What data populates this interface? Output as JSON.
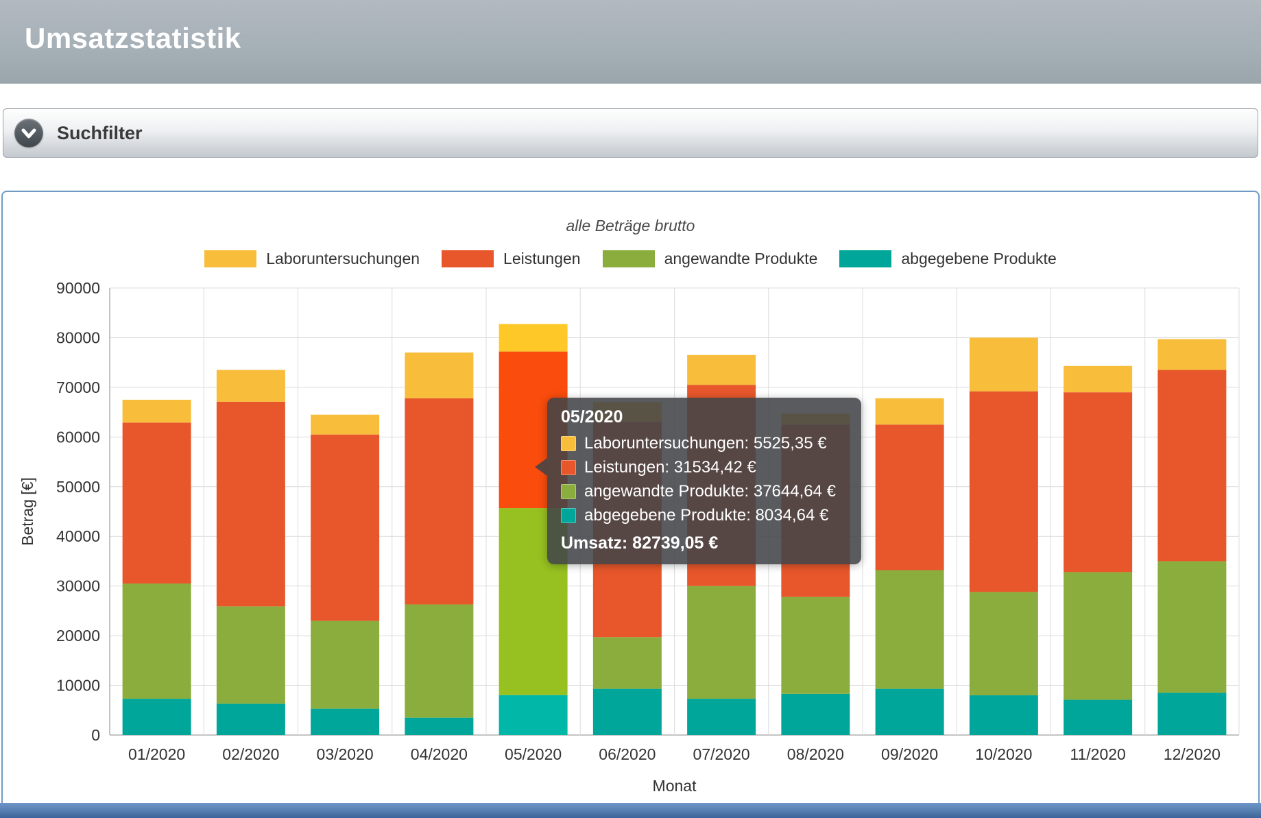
{
  "header": {
    "title": "Umsatzstatistik"
  },
  "filter": {
    "label": "Suchfilter"
  },
  "colors": {
    "header_bg": "#a6b0b7",
    "panel_border": "#6f9ac4",
    "footer_strip": "#557dae",
    "grid": "#dcdcdc",
    "axis": "#8a8a8a"
  },
  "chart_data": {
    "type": "bar",
    "stacked": true,
    "title": "alle Beträge brutto",
    "xlabel": "Monat",
    "ylabel": "Betrag [€]",
    "ylim": [
      0,
      90000
    ],
    "ytick_step": 10000,
    "grid": true,
    "legend_position": "top",
    "categories": [
      "01/2020",
      "02/2020",
      "03/2020",
      "04/2020",
      "05/2020",
      "06/2020",
      "07/2020",
      "08/2020",
      "09/2020",
      "10/2020",
      "11/2020",
      "12/2020"
    ],
    "series": [
      {
        "name": "abgegebene Produkte",
        "color": "#00A69A",
        "highlight_color": "#00B7A8",
        "values": [
          7300,
          6300,
          5300,
          3500,
          8034.64,
          9300,
          7300,
          8300,
          9300,
          8000,
          7100,
          8500
        ]
      },
      {
        "name": "angewandte Produkte",
        "color": "#8BAD3D",
        "highlight_color": "#96C121",
        "values": [
          23200,
          19600,
          17700,
          22800,
          37644.64,
          10400,
          22700,
          19500,
          23900,
          20800,
          25700,
          26500
        ]
      },
      {
        "name": "Leistungen",
        "color": "#E7572B",
        "highlight_color": "#F94C0D",
        "values": [
          32400,
          41200,
          37500,
          41500,
          31534.42,
          43300,
          40500,
          34700,
          29300,
          40400,
          36200,
          38500
        ]
      },
      {
        "name": "Laboruntersuchungen",
        "color": "#F8BE3B",
        "highlight_color": "#FFC829",
        "values": [
          4600,
          6400,
          4000,
          9200,
          5525.35,
          4000,
          6000,
          2200,
          5300,
          10800,
          5300,
          6200
        ]
      }
    ],
    "legend_order": [
      "Laboruntersuchungen",
      "Leistungen",
      "angewandte Produkte",
      "abgegebene Produkte"
    ],
    "highlight_index": 4
  },
  "tooltip": {
    "title": "05/2020",
    "rows": [
      {
        "color": "#F8BE3B",
        "text": "Laboruntersuchungen: 5525,35 €"
      },
      {
        "color": "#E7572B",
        "text": "Leistungen: 31534,42 €"
      },
      {
        "color": "#8BAD3D",
        "text": "angewandte Produkte: 37644,64 €"
      },
      {
        "color": "#00A69A",
        "text": "abgegebene Produkte: 8034,64 €"
      }
    ],
    "total_text": "Umsatz: 82739,05 €"
  }
}
